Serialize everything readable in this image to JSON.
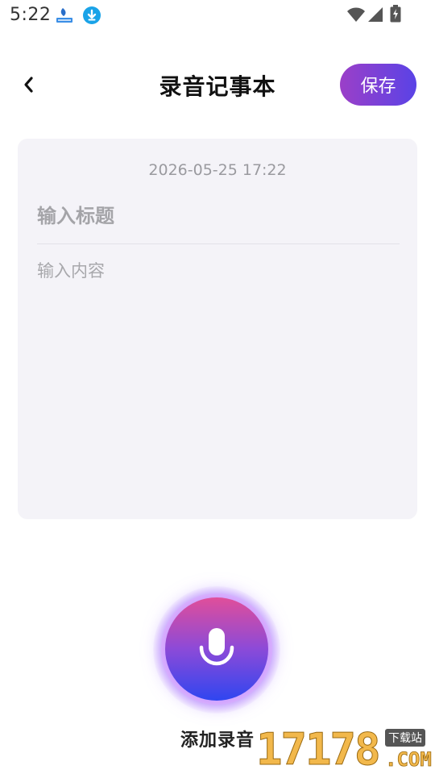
{
  "status_bar": {
    "time": "5:22",
    "icons": [
      "app-notification-icon",
      "download-icon",
      "wifi-icon",
      "signal-icon",
      "battery-charging-icon"
    ]
  },
  "header": {
    "title": "录音记事本",
    "save_label": "保存",
    "back_icon": "chevron-left-icon"
  },
  "note": {
    "date": "2026-05-25 17:22",
    "title_placeholder": "输入标题",
    "content_placeholder": "输入内容"
  },
  "record": {
    "label": "添加录音",
    "icon": "microphone-icon"
  },
  "watermark": {
    "number": "17178",
    "badge": "下载站",
    "suffix": ".COM"
  },
  "colors": {
    "save_gradient_start": "#9b3fc8",
    "save_gradient_end": "#5a43e6",
    "card_background": "#f4f3f8",
    "record_gradient_top": "#e04e9a",
    "record_gradient_bottom": "#2f46f0"
  }
}
